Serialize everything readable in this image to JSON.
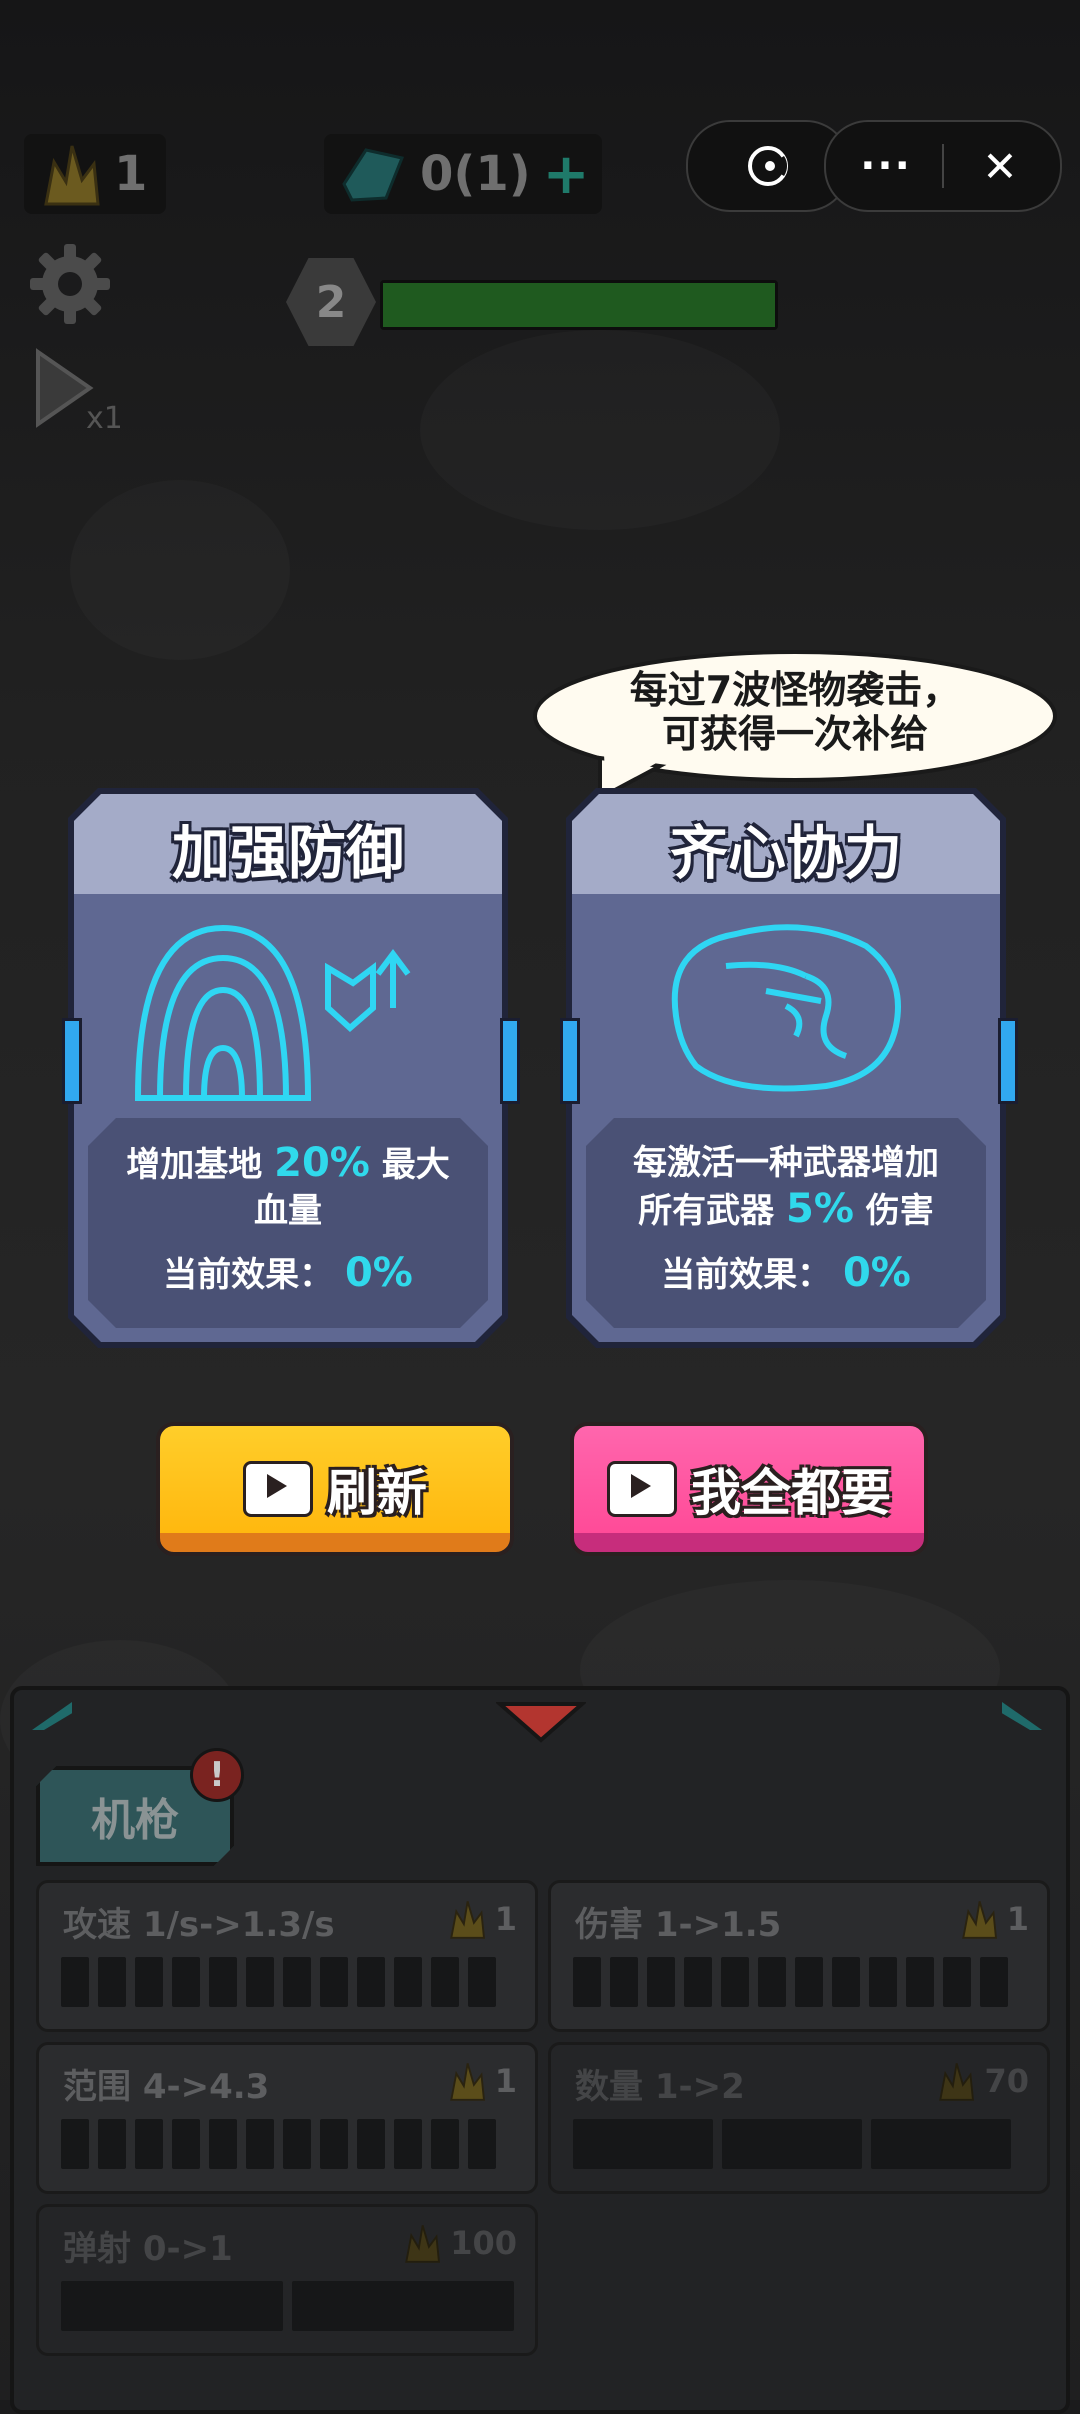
{
  "hud": {
    "gold_count": "1",
    "gem_count": "0(1)",
    "plus_symbol": "+",
    "wave_number": "2",
    "wave_progress": 1.0
  },
  "capsule": {
    "more_symbol": "···",
    "close_symbol": "✕"
  },
  "speech_bubble": {
    "line1": "每过7波怪物袭击，",
    "line2": "可获得一次补给"
  },
  "cards": [
    {
      "title": "加强防御",
      "desc_pre": "增加基地",
      "desc_value": "20%",
      "desc_post": "最大",
      "desc_line2": "血量",
      "effect_label": "当前效果：",
      "effect_value": "0%"
    },
    {
      "title": "齐心协力",
      "desc_line1": "每激活一种武器增加",
      "desc_pre": "所有武器",
      "desc_value": "5%",
      "desc_post": "伤害",
      "effect_label": "当前效果：",
      "effect_value": "0%"
    }
  ],
  "buttons": {
    "refresh_label": "刷新",
    "take_all_label": "我全都要"
  },
  "weapon_panel": {
    "weapon_tab": "机枪",
    "alert_symbol": "!",
    "stats": [
      {
        "label": "攻速 1/s->1.3/s",
        "cost": "1"
      },
      {
        "label": "伤害 1->1.5",
        "cost": "1"
      },
      {
        "label": "范围 4->4.3",
        "cost": "1"
      },
      {
        "label": "数量 1->2",
        "cost": "70"
      },
      {
        "label": "弹射 0->1",
        "cost": "100"
      }
    ]
  },
  "colors": {
    "card_glow": "#2fd6f3",
    "refresh_button": "#ffc417",
    "take_all_button": "#ff5aa3",
    "highlight_cyan": "#30d9ec"
  }
}
